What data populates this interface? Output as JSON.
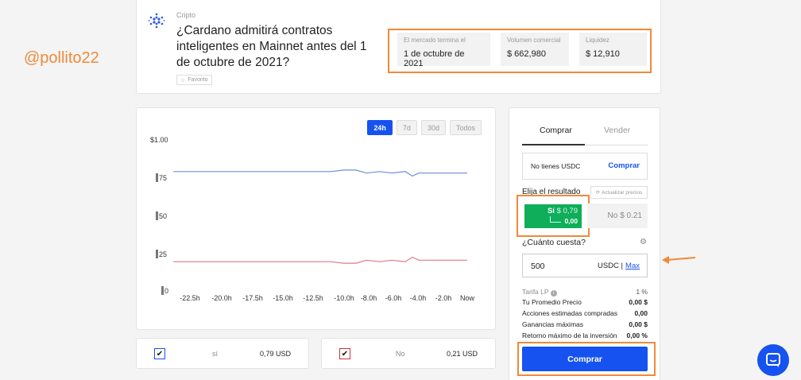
{
  "watermark": "@pollito22",
  "header": {
    "category": "Cripto",
    "question": "¿Cardano admitirá contratos inteligentes en Mainnet antes del 1 de octubre de 2021?",
    "favorite": "Favorito",
    "stats": [
      {
        "label": "El mercado termina el",
        "value": "1 de octubre de 2021"
      },
      {
        "label": "Volumen comercial",
        "value": "$ 662,980"
      },
      {
        "label": "Liquidez",
        "value": "$ 12,910"
      }
    ]
  },
  "chart": {
    "tabs": [
      "24h",
      "7d",
      "30d",
      "Todos"
    ],
    "active_tab": "24h",
    "y_ticks": [
      "$1.00",
      "75",
      "50",
      "25",
      "0"
    ],
    "x_ticks": [
      "-22.5h",
      "-20.0h",
      "-17.5h",
      "-15.0h",
      "-12.5h",
      "-10.0h",
      "-8.0h",
      "-6.0h",
      "-4.0h",
      "-2.0h",
      "Now"
    ]
  },
  "chart_data": {
    "type": "line",
    "x": [
      "-24h",
      "-22.5h",
      "-20.0h",
      "-17.5h",
      "-15.0h",
      "-12.5h",
      "-11.0h",
      "-10.0h",
      "-9.0h",
      "-8.0h",
      "-7.0h",
      "-6.0h",
      "-5.0h",
      "-4.5h",
      "-4.0h",
      "-3.0h",
      "-2.0h",
      "-1.0h",
      "Now"
    ],
    "series": [
      {
        "values": [
          0.8,
          0.8,
          0.8,
          0.8,
          0.8,
          0.8,
          0.8,
          0.81,
          0.81,
          0.79,
          0.8,
          0.79,
          0.8,
          0.77,
          0.79,
          0.79,
          0.79,
          0.79,
          0.79
        ],
        "color": "#6b8fd6"
      },
      {
        "values": [
          0.2,
          0.2,
          0.2,
          0.2,
          0.2,
          0.2,
          0.2,
          0.19,
          0.19,
          0.21,
          0.2,
          0.21,
          0.2,
          0.23,
          0.21,
          0.21,
          0.21,
          0.21,
          0.21
        ],
        "color": "#e07a8e"
      }
    ],
    "ylim": [
      0,
      1
    ],
    "grid": false
  },
  "outcomes": [
    {
      "name": "sí",
      "price": "0,79 USD",
      "color": "#1652f0"
    },
    {
      "name": "No",
      "price": "0,21 USD",
      "color": "#d0343a"
    }
  ],
  "trade": {
    "tab_buy": "Comprar",
    "tab_sell": "Vender",
    "balance_text": "No tienes USDC",
    "balance_link": "Comprar",
    "choose_label": "Elija el resultado",
    "update_prices": "Actualizar precios",
    "yes_label": "Sí",
    "yes_price": "$ 0,79",
    "yes_sub": "0,00",
    "no_label": "No",
    "no_price": "$ 0.21",
    "cost_label": "¿Cuánto cuesta?",
    "amount": "500",
    "currency": "USDC |",
    "max": "Max",
    "lp_label": "Tarifa LP",
    "lp_value": "1 %",
    "rows": [
      {
        "label": "Tu Promedio Precio",
        "value": "0,00 $"
      },
      {
        "label": "Acciones estimadas compradas",
        "value": "0,00"
      },
      {
        "label": "Ganancias máximas",
        "value": "0,00 $"
      },
      {
        "label": "Retorno máximo de la inversión",
        "value": "0,00 %"
      }
    ],
    "buy_button": "Comprar"
  },
  "colors": {
    "accent": "#1652f0",
    "yes": "#0fae5a",
    "highlight": "#ef8a3a"
  }
}
